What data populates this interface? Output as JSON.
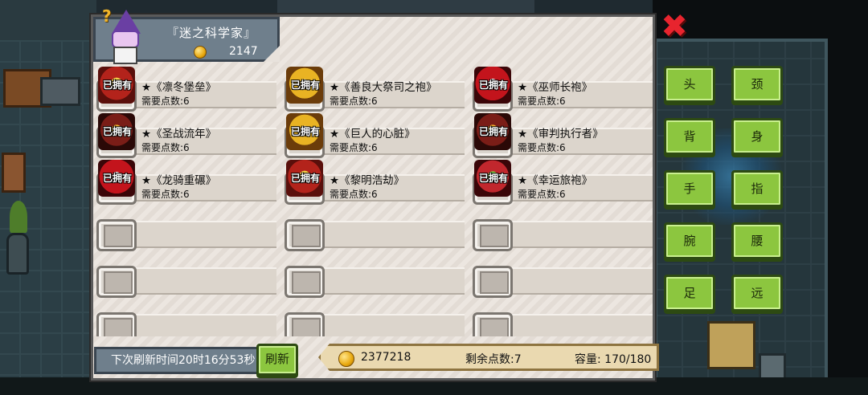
{
  "merchant": {
    "name": "『迷之科学家』",
    "price": "2147"
  },
  "owned_label": "已拥有",
  "items": [
    {
      "name": "★《凛冬堡垒》",
      "cost": "需要点数:6",
      "owned": true,
      "art": "red"
    },
    {
      "name": "★《善良大祭司之袍》",
      "cost": "需要点数:6",
      "owned": true,
      "art": "gold"
    },
    {
      "name": "★《巫师长袍》",
      "cost": "需要点数:6",
      "owned": true,
      "art": "crimson"
    },
    {
      "name": "★《圣战流年》",
      "cost": "需要点数:6",
      "owned": true,
      "art": "dark"
    },
    {
      "name": "★《巨人的心脏》",
      "cost": "需要点数:6",
      "owned": true,
      "art": "gold"
    },
    {
      "name": "★《审判执行者》",
      "cost": "需要点数:6",
      "owned": true,
      "art": "dark"
    },
    {
      "name": "★《龙骑重碾》",
      "cost": "需要点数:6",
      "owned": true,
      "art": "crimson"
    },
    {
      "name": "★《黎明浩劫》",
      "cost": "需要点数:6",
      "owned": true,
      "art": "red"
    },
    {
      "name": "★《幸运旅袍》",
      "cost": "需要点数:6",
      "owned": true,
      "art": "green"
    },
    {
      "empty": true
    },
    {
      "empty": true
    },
    {
      "empty": true
    },
    {
      "empty": true
    },
    {
      "empty": true
    },
    {
      "empty": true
    },
    {
      "empty": true
    },
    {
      "empty": true
    },
    {
      "empty": true
    }
  ],
  "footer": {
    "refresh_time": "下次刷新时间20时16分53秒",
    "refresh_button": "刷新",
    "gold": "2377218",
    "points": "剩余点数:7",
    "capacity": "容量:  170/180"
  },
  "categories": [
    {
      "id": "head",
      "label": "头"
    },
    {
      "id": "neck",
      "label": "颈"
    },
    {
      "id": "back",
      "label": "背"
    },
    {
      "id": "body",
      "label": "身"
    },
    {
      "id": "hand",
      "label": "手"
    },
    {
      "id": "finger",
      "label": "指"
    },
    {
      "id": "wrist",
      "label": "腕"
    },
    {
      "id": "waist",
      "label": "腰"
    },
    {
      "id": "foot",
      "label": "足"
    },
    {
      "id": "ranged",
      "label": "远"
    }
  ],
  "close_label": "✖",
  "colors": {
    "button_green": "#8cc63f",
    "close_red": "#e8242e",
    "panel_bg": "#e8e2dc",
    "header_slate": "#6f7f8c"
  }
}
